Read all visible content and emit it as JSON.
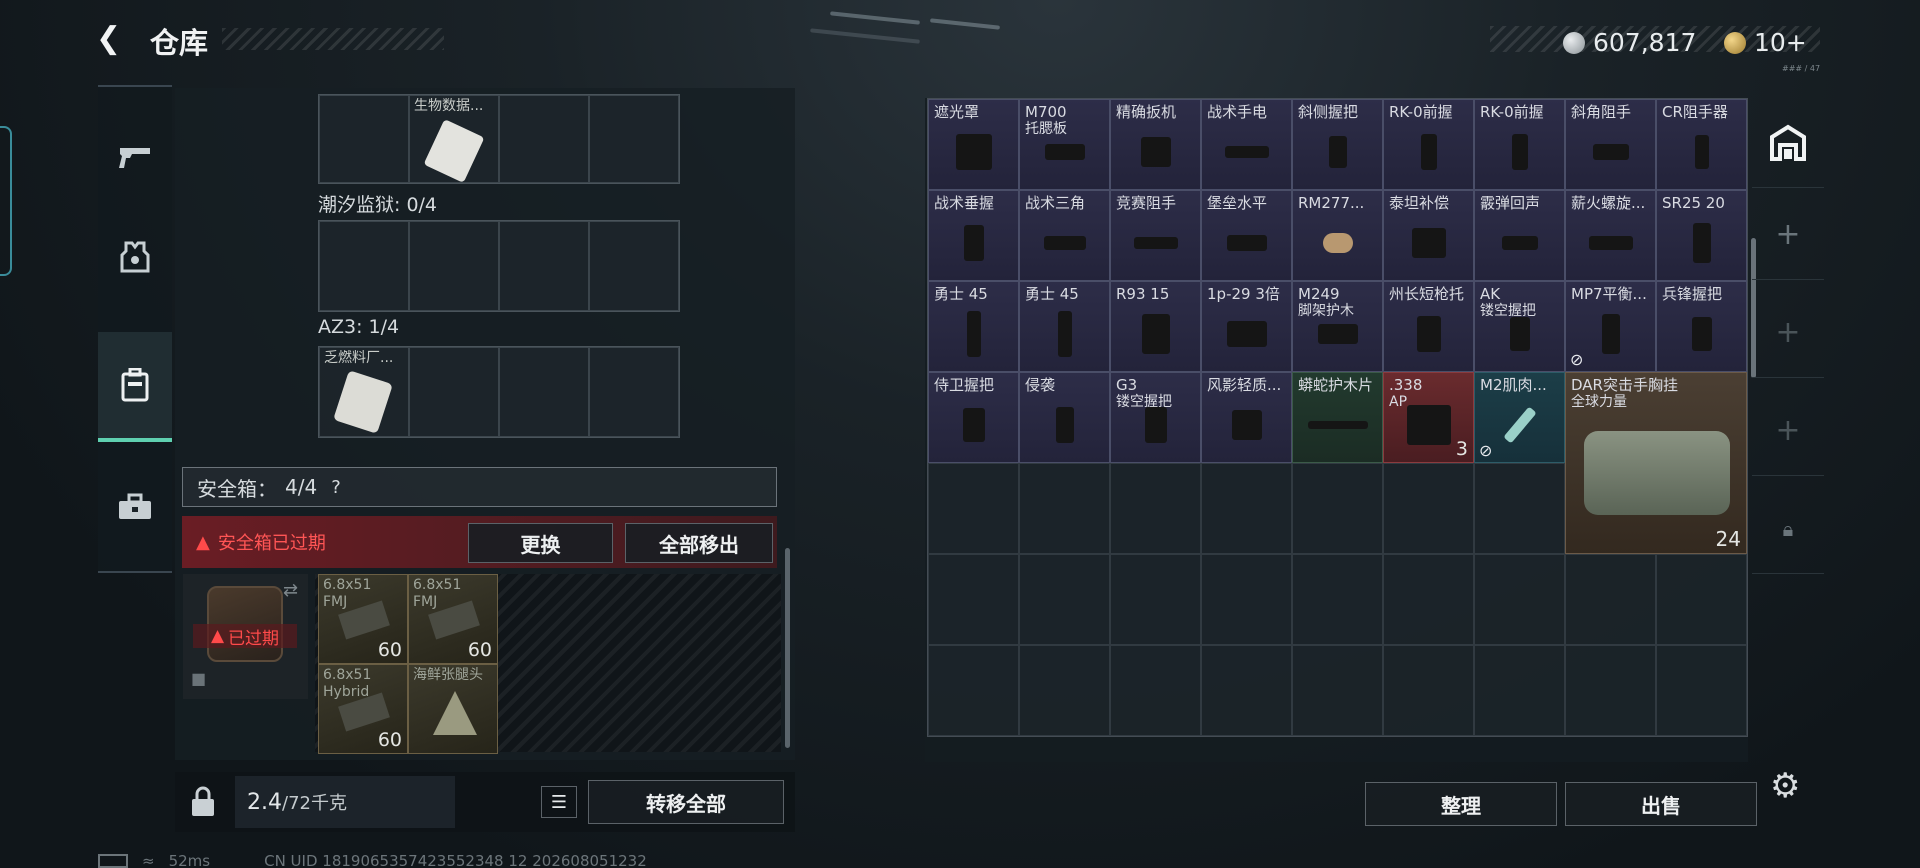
{
  "header": {
    "title": "仓库",
    "currency_amount": "607,817",
    "secondary_amount": "10+",
    "hud_code": "### / 47"
  },
  "colors": {
    "accent": "#5fd0b0",
    "danger": "#e0404a",
    "expired_bg": "#5a1e24"
  },
  "sidenav": {
    "items": [
      {
        "id": "weapons",
        "icon": "gun-icon"
      },
      {
        "id": "gear",
        "icon": "armor-icon"
      },
      {
        "id": "container",
        "icon": "case-icon",
        "active": true
      },
      {
        "id": "toolbox",
        "icon": "toolbox-icon"
      }
    ]
  },
  "left": {
    "top_item_label": "生物数据...",
    "tidal_prison_label": "潮汐监狱: 0/4",
    "az3_label": "AZ3: 1/4",
    "az3_item_label": "乏燃料厂...",
    "safebox": {
      "title": "安全箱：",
      "count": "4/4",
      "help": "?"
    },
    "expired_banner": "安全箱已过期",
    "replace_btn": "更换",
    "move_all_out_btn": "全部移出",
    "expired_tag": "已过期",
    "ammo": [
      {
        "name": "6.8x51",
        "sub": "FMJ",
        "qty": "60"
      },
      {
        "name": "6.8x51",
        "sub": "FMJ",
        "qty": "60"
      },
      {
        "name": "6.8x51",
        "sub": "Hybrid",
        "qty": "60"
      },
      {
        "name": "海鲜张腿头",
        "sub": "",
        "qty": ""
      }
    ],
    "weight_value": "2.4",
    "weight_unit": "/72千克",
    "transfer_all_btn": "转移全部"
  },
  "inventory": {
    "items": [
      {
        "n1": "遮光罩",
        "n2": ""
      },
      {
        "n1": "M700",
        "n2": "托腮板"
      },
      {
        "n1": "精确扳机",
        "n2": ""
      },
      {
        "n1": "战术手电",
        "n2": ""
      },
      {
        "n1": "斜侧握把",
        "n2": ""
      },
      {
        "n1": "RK-0前握",
        "n2": ""
      },
      {
        "n1": "RK-0前握",
        "n2": ""
      },
      {
        "n1": "斜角阻手",
        "n2": ""
      },
      {
        "n1": "CR阻手器",
        "n2": ""
      },
      {
        "n1": "战术垂握",
        "n2": ""
      },
      {
        "n1": "战术三角",
        "n2": ""
      },
      {
        "n1": "竞赛阻手",
        "n2": ""
      },
      {
        "n1": "堡垒水平",
        "n2": ""
      },
      {
        "n1": "RM277...",
        "n2": ""
      },
      {
        "n1": "泰坦补偿",
        "n2": ""
      },
      {
        "n1": "霰弹回声",
        "n2": ""
      },
      {
        "n1": "薪火螺旋...",
        "n2": ""
      },
      {
        "n1": "SR25 20",
        "n2": ""
      },
      {
        "n1": "勇士 45",
        "n2": ""
      },
      {
        "n1": "勇士 45",
        "n2": ""
      },
      {
        "n1": "R93 15",
        "n2": ""
      },
      {
        "n1": "1p-29 3倍",
        "n2": ""
      },
      {
        "n1": "M249",
        "n2": "脚架护木"
      },
      {
        "n1": "州长短枪托",
        "n2": ""
      },
      {
        "n1": "AK",
        "n2": "镂空握把"
      },
      {
        "n1": "MP7平衡...",
        "n2": ""
      },
      {
        "n1": "兵锋握把",
        "n2": ""
      },
      {
        "n1": "侍卫握把",
        "n2": ""
      },
      {
        "n1": "侵袭",
        "n2": ""
      },
      {
        "n1": "G3",
        "n2": "镂空握把"
      },
      {
        "n1": "风影轻质...",
        "n2": ""
      },
      {
        "n1": "蟒蛇护木片",
        "n2": ""
      },
      {
        "n1": ".338",
        "n2": "AP"
      },
      {
        "n1": "M2肌肉...",
        "n2": ""
      }
    ],
    "ammo_qty": "3",
    "bag": {
      "n1": "DAR突击手胸挂",
      "n2": "全球力量",
      "qty": "24"
    },
    "sort_btn": "整理",
    "sell_btn": "出售"
  },
  "status": {
    "ping": "52ms",
    "uid": "CN UID 1819065357423552348 12 202608051232"
  }
}
